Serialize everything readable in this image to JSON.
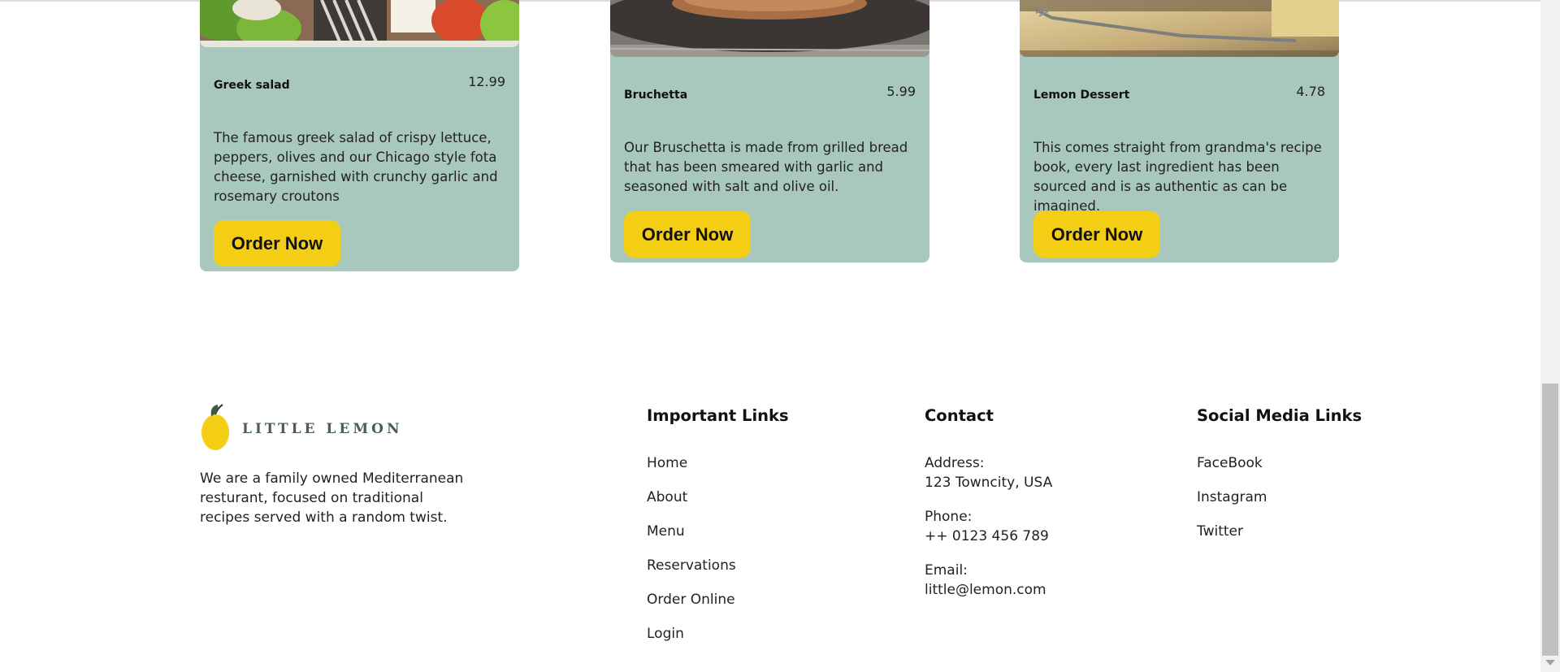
{
  "menu": {
    "cards": [
      {
        "name": "Greek salad",
        "price": "12.99",
        "description": "The famous greek salad of crispy lettuce, peppers, olives and our Chicago style fota cheese, garnished with crunchy garlic and rosemary croutons",
        "button": "Order Now"
      },
      {
        "name": "Bruchetta",
        "price": "5.99",
        "description": "Our Bruschetta is made from grilled bread that has been smeared with garlic and seasoned with salt and olive oil.",
        "button": "Order Now"
      },
      {
        "name": "Lemon Dessert",
        "price": "4.78",
        "description": "This comes straight from grandma's recipe book, every last ingredient has been sourced and is as authentic as can be imagined.",
        "button": "Order Now"
      }
    ]
  },
  "footer": {
    "logo_text": "LITTLE LEMON",
    "about": "We are a family owned Mediterranean resturant, focused on traditional recipes served with a random twist.",
    "important_links": {
      "heading": "Important Links",
      "items": [
        "Home",
        "About",
        "Menu",
        "Reservations",
        "Order Online",
        "Login"
      ]
    },
    "contact": {
      "heading": "Contact",
      "address_label": "Address:",
      "address": "123 Towncity, USA",
      "phone_label": "Phone:",
      "phone": "++ 0123 456 789",
      "email_label": "Email:",
      "email": "little@lemon.com"
    },
    "social": {
      "heading": "Social Media Links",
      "items": [
        "FaceBook",
        "Instagram",
        "Twitter"
      ]
    }
  },
  "colors": {
    "card_bg": "#a9c8bd",
    "button_bg": "#f4ce14",
    "brand_green": "#495e57"
  }
}
